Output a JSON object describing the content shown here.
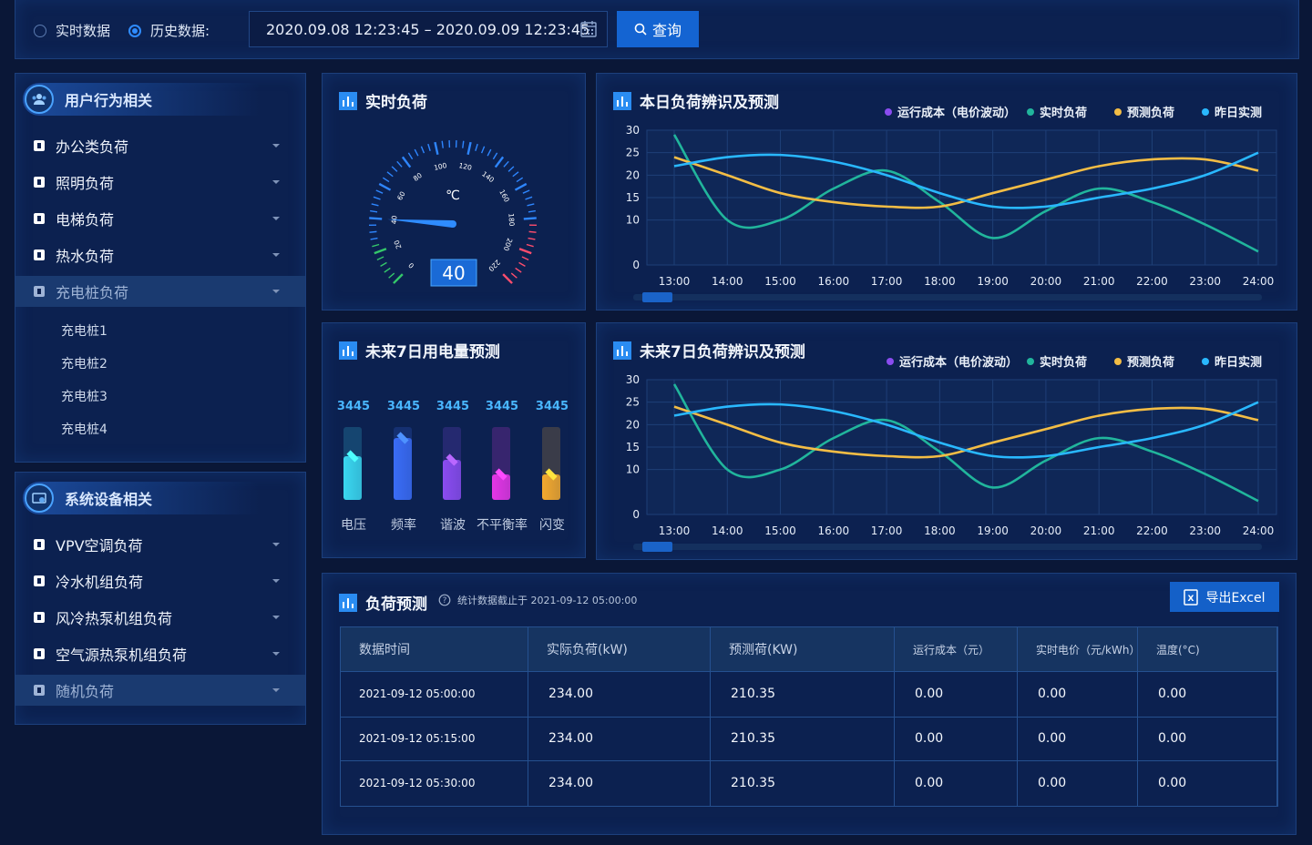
{
  "topbar": {
    "radio_realtime": "实时数据",
    "radio_history": "历史数据:",
    "date_range": "2020.09.08 12:23:45 – 2020.09.09 12:23:45",
    "query_label": "查询"
  },
  "sidebar_user": {
    "title": "用户行为相关",
    "items": [
      {
        "label": "办公类负荷"
      },
      {
        "label": "照明负荷"
      },
      {
        "label": "电梯负荷"
      },
      {
        "label": "热水负荷"
      },
      {
        "label": "充电桩负荷"
      }
    ],
    "sub_items": [
      "充电桩1",
      "充电桩2",
      "充电桩3",
      "充电桩4"
    ]
  },
  "sidebar_device": {
    "title": "系统设备相关",
    "items": [
      {
        "label": "VPV空调负荷"
      },
      {
        "label": "冷水机组负荷"
      },
      {
        "label": "风冷热泵机组负荷"
      },
      {
        "label": "空气源热泵机组负荷"
      },
      {
        "label": "随机负荷"
      }
    ]
  },
  "gauge": {
    "title": "实时负荷",
    "unit": "℃",
    "value": 40,
    "value_text": "40",
    "min": 0,
    "max": 220,
    "ticks": [
      "0",
      "20",
      "40",
      "60",
      "80",
      "100",
      "120",
      "140",
      "160",
      "180",
      "200",
      "220"
    ]
  },
  "forecast7": {
    "title": "未来7日用电量预测",
    "bars": [
      {
        "label": "电压",
        "value_text": "3445",
        "fill": 0.6,
        "color": "#3ad7f0"
      },
      {
        "label": "频率",
        "value_text": "3445",
        "fill": 0.85,
        "color": "#3a6cf6"
      },
      {
        "label": "谐波",
        "value_text": "3445",
        "fill": 0.55,
        "color": "#8a4cf0"
      },
      {
        "label": "不平衡率",
        "value_text": "3445",
        "fill": 0.35,
        "color": "#e436e6"
      },
      {
        "label": "闪变",
        "value_text": "3445",
        "fill": 0.35,
        "color": "#f3a92e"
      }
    ]
  },
  "legend": {
    "items": [
      {
        "label": "运行成本（电价波动）",
        "color": "#8a4cf0"
      },
      {
        "label": "实时负荷",
        "color": "#21b59c"
      },
      {
        "label": "预测负荷",
        "color": "#f3bd45"
      },
      {
        "label": "昨日实测",
        "color": "#29b8ff"
      }
    ]
  },
  "chart_today_title": "本日负荷辨识及预测",
  "chart_7day_title": "未来7日负荷辨识及预测",
  "chart_data": [
    {
      "type": "line",
      "title": "本日负荷辨识及预测",
      "x": [
        "13:00",
        "14:00",
        "15:00",
        "16:00",
        "17:00",
        "18:00",
        "19:00",
        "20:00",
        "21:00",
        "22:00",
        "23:00",
        "24:00"
      ],
      "ylim": [
        0,
        30
      ],
      "yticks": [
        0,
        10,
        15,
        20,
        25,
        30
      ],
      "series": [
        {
          "name": "实时负荷",
          "color": "#21b59c",
          "values": [
            29,
            10,
            10,
            17,
            21,
            14,
            6,
            12,
            17,
            14,
            9,
            3
          ]
        },
        {
          "name": "预测负荷",
          "color": "#f3bd45",
          "values": [
            24,
            20,
            16,
            14,
            13,
            13,
            16,
            19,
            22,
            23.5,
            23.5,
            21
          ]
        },
        {
          "name": "昨日实测",
          "color": "#29b8ff",
          "values": [
            22,
            24,
            24.5,
            23,
            20,
            16,
            13,
            13,
            15,
            17,
            20,
            25
          ]
        }
      ]
    },
    {
      "type": "line",
      "title": "未来7日负荷辨识及预测",
      "x": [
        "13:00",
        "14:00",
        "15:00",
        "16:00",
        "17:00",
        "18:00",
        "19:00",
        "20:00",
        "21:00",
        "22:00",
        "23:00",
        "24:00"
      ],
      "ylim": [
        0,
        30
      ],
      "yticks": [
        0,
        10,
        15,
        20,
        25,
        30
      ],
      "series": [
        {
          "name": "实时负荷",
          "color": "#21b59c",
          "values": [
            29,
            10,
            10,
            17,
            21,
            14,
            6,
            12,
            17,
            14,
            9,
            3
          ]
        },
        {
          "name": "预测负荷",
          "color": "#f3bd45",
          "values": [
            24,
            20,
            16,
            14,
            13,
            13,
            16,
            19,
            22,
            23.5,
            23.5,
            21
          ]
        },
        {
          "name": "昨日实测",
          "color": "#29b8ff",
          "values": [
            22,
            24,
            24.5,
            23,
            20,
            16,
            13,
            13,
            15,
            17,
            20,
            25
          ]
        }
      ]
    }
  ],
  "forecast_table": {
    "title": "负荷预测",
    "note": "统计数据截止于 2021-09-12 05:00:00",
    "export_label": "导出Excel",
    "columns": [
      "数据时间",
      "实际负荷(kW)",
      "预测荷(KW)",
      "运行成本（元）",
      "实时电价（元/kWh）",
      "温度(°C)"
    ],
    "rows": [
      [
        "2021-09-12 05:00:00",
        "234.00",
        "210.35",
        "0.00",
        "0.00",
        "0.00"
      ],
      [
        "2021-09-12 05:15:00",
        "234.00",
        "210.35",
        "0.00",
        "0.00",
        "0.00"
      ],
      [
        "2021-09-12 05:30:00",
        "234.00",
        "210.35",
        "0.00",
        "0.00",
        "0.00"
      ]
    ]
  }
}
